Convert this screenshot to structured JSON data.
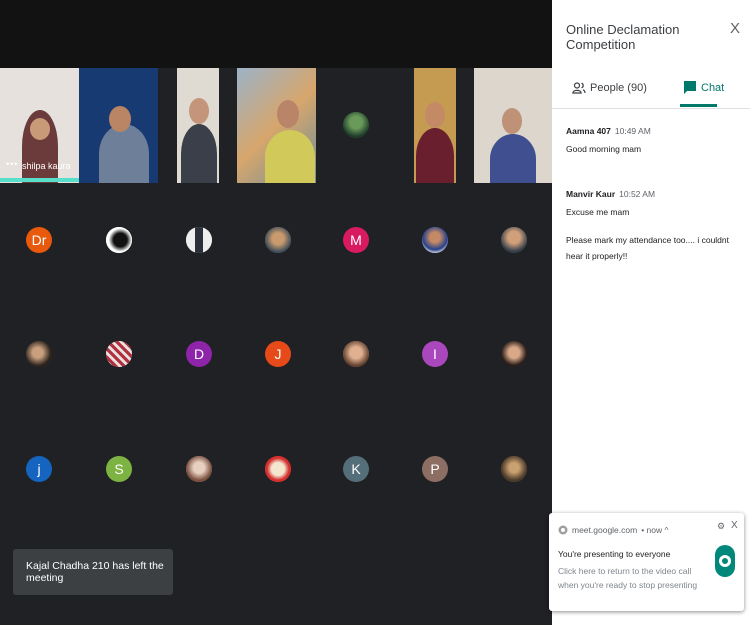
{
  "participants_top": [
    {
      "name": "shilpa kaura",
      "bg": "#e6e1dc"
    },
    {
      "name": "",
      "bg": "#183a73"
    },
    {
      "name": "",
      "bg": "#dfdad2"
    },
    {
      "name": "",
      "bg": "#8f9aa6"
    },
    {
      "name": "",
      "bg": "#202124"
    },
    {
      "name": "",
      "bg": "#c59b52"
    },
    {
      "name": "",
      "bg": "#dcd6cc"
    }
  ],
  "avatars_row1": [
    {
      "letter": "Dr",
      "color": "#e8590c"
    },
    {
      "letter": "",
      "color": "#ffffff"
    },
    {
      "letter": "",
      "color": "#d9d9d9"
    },
    {
      "letter": "",
      "color": "#9a7b5a"
    },
    {
      "letter": "M",
      "color": "#d81b60"
    },
    {
      "letter": "",
      "color": "#3d5aa8"
    },
    {
      "letter": "",
      "color": "#7a6b58"
    }
  ],
  "avatars_row2": [
    {
      "letter": "",
      "color": "#5a4a3d"
    },
    {
      "letter": "",
      "color": "#c7a0a0"
    },
    {
      "letter": "D",
      "color": "#8e24aa"
    },
    {
      "letter": "J",
      "color": "#e64a19"
    },
    {
      "letter": "",
      "color": "#d3a88a"
    },
    {
      "letter": "I",
      "color": "#ab47bc"
    },
    {
      "letter": "",
      "color": "#3e2f2a"
    }
  ],
  "avatars_row3": [
    {
      "letter": "j",
      "color": "#1565c0"
    },
    {
      "letter": "S",
      "color": "#7cb342"
    },
    {
      "letter": "",
      "color": "#a1887f"
    },
    {
      "letter": "",
      "color": "#e53935"
    },
    {
      "letter": "K",
      "color": "#546e7a"
    },
    {
      "letter": "P",
      "color": "#8d6e63"
    },
    {
      "letter": "",
      "color": "#8a6a4a"
    }
  ],
  "toast": {
    "text": "Kajal Chadha 210 has left the meeting"
  },
  "panel": {
    "title": "Online Declamation Competition",
    "close": "X",
    "people_tab": "People (90)",
    "chat_tab": "Chat"
  },
  "messages": [
    {
      "author": "Aamna 407",
      "time": "10:49 AM",
      "lines": [
        "Good morning mam"
      ]
    },
    {
      "author": "Manvir Kaur",
      "time": "10:52 AM",
      "lines": [
        "Excuse me mam",
        "Please mark my attendance too.... i couldnt hear it properly!!"
      ]
    }
  ],
  "notification": {
    "source": "meet.google.com",
    "when": "• now ^",
    "title": "You're presenting to everyone",
    "body": "Click here to return to the video call when you're ready to stop presenting",
    "gear": "⚙",
    "close": "X"
  },
  "colors": {
    "accent": "#00796b",
    "speaking": "#58dfc9",
    "background": "#202124"
  }
}
